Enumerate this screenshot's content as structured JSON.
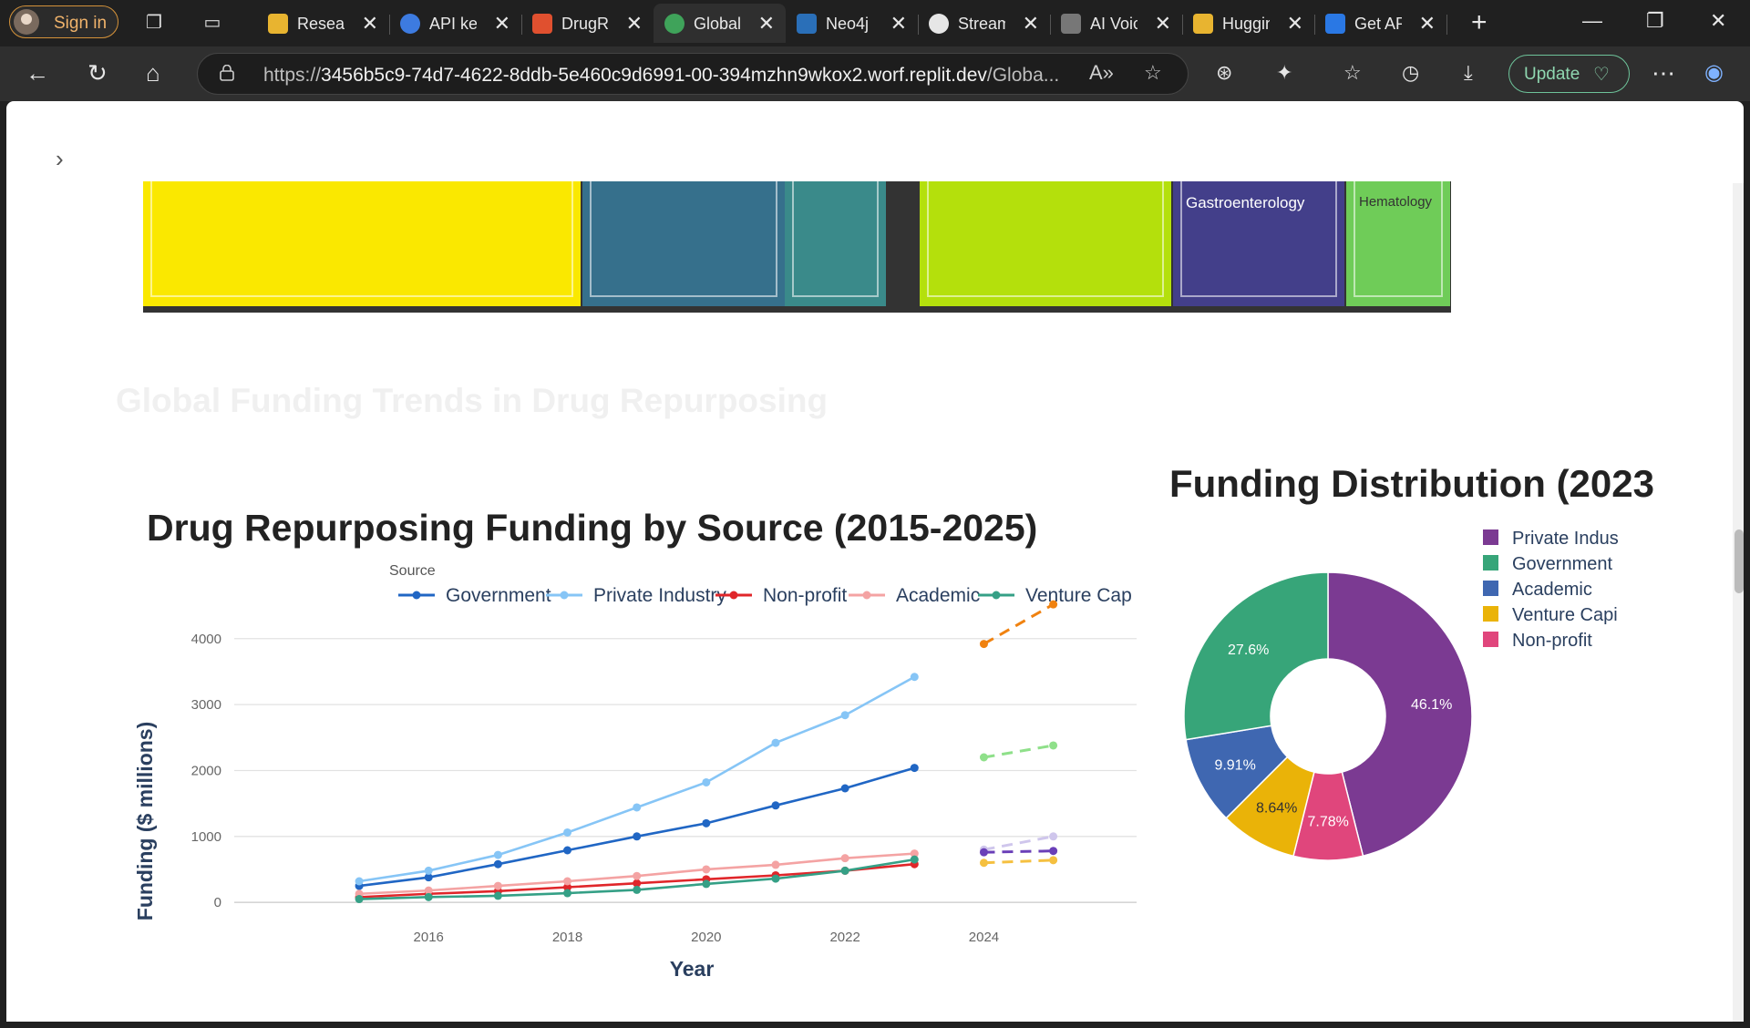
{
  "browser": {
    "signin_label": "Sign in",
    "tabs": [
      {
        "title": "Research",
        "favicon": "huggingface-icon",
        "color": "#e8b430"
      },
      {
        "title": "API keys",
        "favicon": "openai-icon",
        "color": "#3d7be0"
      },
      {
        "title": "DrugRe",
        "favicon": "streamlit-icon",
        "color": "#e0502f"
      },
      {
        "title": "Global",
        "favicon": "globe-icon",
        "color": "#3fa35a"
      },
      {
        "title": "Neo4j",
        "favicon": "neo4j-icon",
        "color": "#2a6fb8"
      },
      {
        "title": "Stream",
        "favicon": "chatgpt-icon",
        "color": "#e6e6e6"
      },
      {
        "title": "AI Voic",
        "favicon": "pause-icon",
        "color": "#777777"
      },
      {
        "title": "Huggin",
        "favicon": "huggingface-icon",
        "color": "#e8b430"
      },
      {
        "title": "Get AP",
        "favicon": "butterfly-icon",
        "color": "#2a78e4"
      }
    ],
    "active_tab_index": 3,
    "url_prefix": "https://",
    "url_host": "3456b5c9-74d7-4622-8ddb-5e460c9d6991-00-394mzhn9wkox2.worf.replit.dev",
    "url_path": "/Globa...",
    "update_label": "Update"
  },
  "treemap": {
    "labels": [
      "Gastroenterology",
      "Hematology"
    ],
    "cells": [
      {
        "color": "#fae800"
      },
      {
        "color": "#36708c"
      },
      {
        "color": "#3a8a8a"
      },
      {
        "color": "#b4e00c"
      },
      {
        "color": "#433f8a",
        "label_index": 0,
        "label_color": "#ffffff"
      },
      {
        "color": "#6fcc58",
        "label_index": 1,
        "label_color": "#333333"
      }
    ]
  },
  "section_title": "Global Funding Trends in Drug Repurposing",
  "chart_data": [
    {
      "type": "line",
      "title": "Drug Repurposing Funding by Source (2015-2025)",
      "legend_title": "Source",
      "legend_placement": "top",
      "xlabel": "Year",
      "ylabel": "Funding ($ millions)",
      "x": [
        2015,
        2016,
        2017,
        2018,
        2019,
        2020,
        2021,
        2022,
        2023
      ],
      "x_ticks": [
        2016,
        2018,
        2020,
        2022,
        2024
      ],
      "y_ticks": [
        0,
        1000,
        2000,
        3000,
        4000
      ],
      "xlim": [
        2013.2,
        2026.2
      ],
      "ylim": [
        -150,
        4550
      ],
      "grid": true,
      "series": [
        {
          "name": "Government",
          "color": "#2066c4",
          "values": [
            250,
            380,
            580,
            790,
            1000,
            1200,
            1470,
            1730,
            2040
          ]
        },
        {
          "name": "Private Industry",
          "color": "#86c5f6",
          "values": [
            320,
            480,
            720,
            1060,
            1440,
            1820,
            2420,
            2840,
            3420
          ]
        },
        {
          "name": "Non-profit",
          "color": "#e0262a",
          "values": [
            80,
            130,
            170,
            230,
            290,
            350,
            410,
            480,
            580
          ]
        },
        {
          "name": "Academic",
          "color": "#f4a3a3",
          "values": [
            130,
            180,
            250,
            320,
            400,
            500,
            570,
            670,
            740
          ]
        },
        {
          "name": "Venture Cap",
          "color": "#35a086",
          "values": [
            50,
            80,
            100,
            140,
            190,
            280,
            360,
            480,
            650
          ]
        }
      ],
      "projections": [
        {
          "color": "#f08210",
          "x": [
            2024,
            2025
          ],
          "values": [
            3920,
            4520
          ]
        },
        {
          "color": "#8fe08a",
          "x": [
            2024,
            2025
          ],
          "values": [
            2200,
            2380
          ]
        },
        {
          "color": "#cfc6ec",
          "x": [
            2024,
            2025
          ],
          "values": [
            800,
            1000
          ]
        },
        {
          "color": "#6a3fb8",
          "x": [
            2024,
            2025
          ],
          "values": [
            760,
            780
          ]
        },
        {
          "color": "#f5c040",
          "x": [
            2024,
            2025
          ],
          "values": [
            600,
            640
          ]
        }
      ]
    },
    {
      "type": "pie",
      "title": "Funding Distribution (2023",
      "legend_placement": "top-right",
      "labels": [
        "Private Indus",
        "Government",
        "Academic",
        "Venture Capi",
        "Non-profit"
      ],
      "values": [
        46.1,
        27.6,
        9.91,
        8.64,
        7.78
      ],
      "value_labels": [
        "46.1%",
        "27.6%",
        "9.91%",
        "8.64%",
        "7.78%"
      ],
      "colors": [
        "#7b3a92",
        "#37a579",
        "#3f67b1",
        "#eab308",
        "#e0467c"
      ],
      "label_colors": [
        "#ffffff",
        "#ffffff",
        "#ffffff",
        "#333333",
        "#ffffff"
      ],
      "order_clockwise_from_top": [
        0,
        4,
        3,
        2,
        1
      ]
    }
  ]
}
